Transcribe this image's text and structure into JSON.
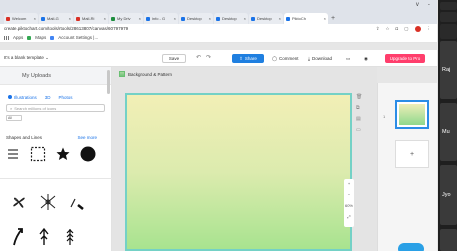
{
  "browser": {
    "tabs": [
      {
        "label": "Welcom",
        "color": "#d93025"
      },
      {
        "label": "Mail-G",
        "color": "#1a73e8"
      },
      {
        "label": "Mail-Ri",
        "color": "#d93025"
      },
      {
        "label": "My Driv",
        "color": "#1e8e3e"
      },
      {
        "label": "info - G",
        "color": "#1a73e8"
      },
      {
        "label": "Desktop",
        "color": "#1a73e8"
      },
      {
        "label": "Desktop",
        "color": "#1a73e8"
      },
      {
        "label": "Desktop",
        "color": "#1a73e8"
      },
      {
        "label": "PiktoCh",
        "color": "#1a73e8"
      }
    ],
    "new_tab": "+",
    "window_controls": [
      "v",
      "-",
      "□",
      "×"
    ],
    "url": "create.piktochart.com/tools/rtools/28613807/canvas/60797979",
    "bookmarks": [
      "Apps",
      "Maps",
      "Account Settings |..."
    ]
  },
  "toolbar": {
    "template_label": "It's a blank template",
    "save_label": "Save",
    "share_label": "Share",
    "comment_label": "Comment",
    "download_label": "Download",
    "upgrade_label": "Upgrade to Pro"
  },
  "left_panel": {
    "title": "My Uploads",
    "tabs": [
      "Illustrations",
      "3D",
      "Photos"
    ],
    "search_placeholder": "Search millions of icons",
    "filter_value": "All",
    "section_title": "Shapes and Lines",
    "see_more": "See more"
  },
  "canvas": {
    "background_tab": "Background & Pattern",
    "zoom_level": "60%"
  },
  "pages": {
    "current_page": "1"
  },
  "meet": {
    "participants": [
      "Raj",
      "Mu",
      "Jyo"
    ]
  }
}
